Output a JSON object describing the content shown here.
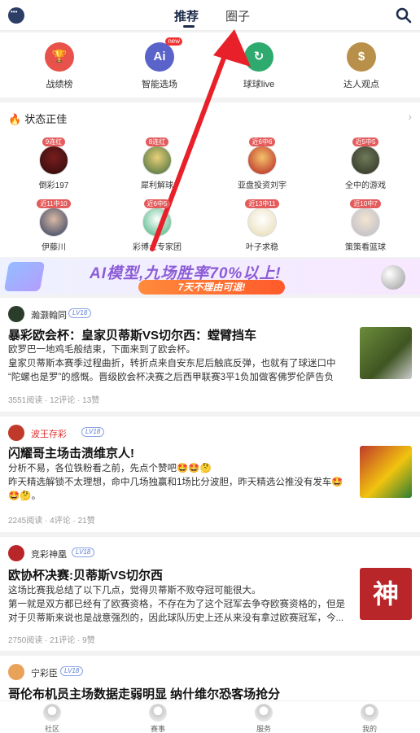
{
  "header": {
    "tabs": [
      {
        "label": "推荐",
        "active": true
      },
      {
        "label": "圈子",
        "active": false
      }
    ],
    "icons": [
      "chat-icon",
      "search-icon"
    ]
  },
  "quick_links": [
    {
      "label": "战绩榜",
      "icon": "trophy-icon",
      "color": "#e8524a"
    },
    {
      "label": "智能选场",
      "icon": "ai-icon",
      "color": "#5a63c9",
      "badge": "new"
    },
    {
      "label": "球球live",
      "icon": "play-icon",
      "color": "#2eaa6e"
    },
    {
      "label": "达人观点",
      "icon": "dollar-icon",
      "color": "#b9904a"
    }
  ],
  "status_section": {
    "title": "状态正佳",
    "people": [
      {
        "name": "倒彩197",
        "badge": "9连红"
      },
      {
        "name": "犀利解球",
        "badge": "8连红"
      },
      {
        "name": "亚盘投资刘宇",
        "badge": "近6中6"
      },
      {
        "name": "全中的游戏",
        "badge": "近5中5"
      },
      {
        "name": "伊藤川",
        "badge": "近11中10"
      },
      {
        "name": "彩博士专家团",
        "badge": "近6中5"
      },
      {
        "name": "叶子求稳",
        "badge": "近13中11"
      },
      {
        "name": "策策看篮球",
        "badge": "近10中7"
      }
    ]
  },
  "banner": {
    "headline": "AI模型,九场胜率70%以上!",
    "cta": "7天不理由可退!"
  },
  "posts": [
    {
      "user": "瀚灏翰同",
      "level": "LV18",
      "title": "暴彩欧会杯：皇家贝蒂斯VS切尔西：螳臂挡车",
      "lines": [
        "欧罗巴一地鸡毛般结束，下面来到了欧会杯。",
        "皇家贝蒂斯本赛季过程曲折，转折点来自安东尼后触底反弹，也就有了球迷口中",
        "“陀螺也是罗”的感慨。晋级欧会杯决赛之后西甲联赛3平1负加做客佛罗伦萨告负"
      ],
      "meta": "3551阅读 · 12评论 · 13赞"
    },
    {
      "user": "波王存彩",
      "level": "LV18",
      "title": "闪耀哥主场击溃维京人!",
      "lines": [
        "分析不易，各位铁粉看之前，先点个赞吧🤩🤩🤔",
        " 昨天精选解锁不太理想，命中几场独赢和1场比分波胆，昨天精选公推没有发车🤩",
        "🤩🤔。"
      ],
      "meta": "2245阅读 · 4评论 · 21赞"
    },
    {
      "user": "竞彩神凰",
      "level": "LV18",
      "title": "欧协杯决赛:贝蒂斯VS切尔西",
      "lines": [
        "这场比赛我总结了以下几点，觉得贝蒂斯不败夺冠可能很大。",
        "第一就是双方都已经有了欧赛资格，不存在为了这个冠军去争夺欧赛资格的，但是",
        "对于贝蒂斯来说也是战意强烈的，因此球队历史上还从来没有拿过欧赛冠军，今..."
      ],
      "thumb_text": "神",
      "meta": "2750阅读 · 21评论 · 9赞"
    },
    {
      "user": "宁彩臣",
      "level": "LV18",
      "title": "哥伦布机员主场数据走弱明显 纳什维尔恐客场抢分"
    }
  ],
  "bottom_nav": [
    "社区",
    "赛事",
    "服务",
    "我的"
  ]
}
